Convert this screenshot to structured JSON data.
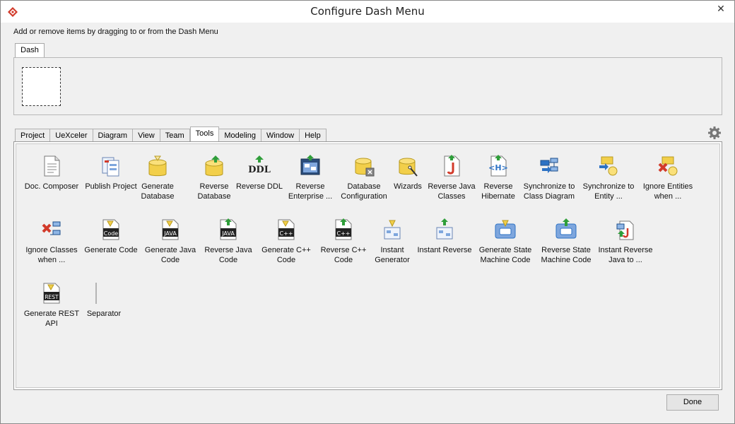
{
  "window": {
    "title": "Configure Dash Menu",
    "close_glyph": "✕"
  },
  "hint": "Add or remove items by dragging to or from the Dash Menu",
  "dash": {
    "tab_label": "Dash"
  },
  "tabs": [
    "Project",
    "UeXceler",
    "Diagram",
    "View",
    "Team",
    "Tools",
    "Modeling",
    "Window",
    "Help"
  ],
  "active_tab": "Tools",
  "items": [
    {
      "label": "Doc. Composer",
      "icon": "doc-composer-icon"
    },
    {
      "label": "Publish Project",
      "icon": "publish-project-icon"
    },
    {
      "label": "Generate\nDatabase",
      "icon": "generate-database-icon"
    },
    {
      "label": "Reverse\nDatabase",
      "icon": "reverse-database-icon"
    },
    {
      "label": "Reverse DDL",
      "icon": "reverse-ddl-icon"
    },
    {
      "label": "Reverse\nEnterprise ...",
      "icon": "reverse-enterprise-icon"
    },
    {
      "label": "Database\nConfiguration",
      "icon": "database-configuration-icon"
    },
    {
      "label": "Wizards",
      "icon": "wizards-icon"
    },
    {
      "label": "Reverse Java\nClasses",
      "icon": "reverse-java-classes-icon"
    },
    {
      "label": "Reverse\nHibernate",
      "icon": "reverse-hibernate-icon"
    },
    {
      "label": "Synchronize to\nClass Diagram",
      "icon": "sync-class-diagram-icon"
    },
    {
      "label": "Synchronize to\nEntity ...",
      "icon": "sync-entity-icon"
    },
    {
      "label": "Ignore Entities\nwhen ...",
      "icon": "ignore-entities-icon"
    },
    {
      "label": "Ignore Classes\nwhen ...",
      "icon": "ignore-classes-icon"
    },
    {
      "label": "Generate Code",
      "icon": "generate-code-icon"
    },
    {
      "label": "Generate Java\nCode",
      "icon": "generate-java-code-icon"
    },
    {
      "label": "Reverse Java\nCode",
      "icon": "reverse-java-code-icon"
    },
    {
      "label": "Generate C++\nCode",
      "icon": "generate-cpp-code-icon"
    },
    {
      "label": "Reverse C++\nCode",
      "icon": "reverse-cpp-code-icon"
    },
    {
      "label": "Instant\nGenerator",
      "icon": "instant-generator-icon"
    },
    {
      "label": "Instant Reverse",
      "icon": "instant-reverse-icon"
    },
    {
      "label": "Generate State\nMachine Code",
      "icon": "generate-state-machine-icon"
    },
    {
      "label": "Reverse State\nMachine Code",
      "icon": "reverse-state-machine-icon"
    },
    {
      "label": "Instant Reverse\nJava to ...",
      "icon": "instant-reverse-java-icon"
    },
    {
      "label": "Generate REST\nAPI",
      "icon": "generate-rest-api-icon"
    },
    {
      "label": "Separator",
      "icon": "separator-icon"
    }
  ],
  "icon_text": {
    "ddl": "DDL",
    "code": "Code",
    "java": "JAVA",
    "cpp": "C++",
    "rest": "REST"
  },
  "buttons": {
    "done": "Done"
  },
  "colors": {
    "accent_green": "#2f9e3a",
    "db_yellow": "#f2cf4a",
    "java_red": "#d23a2a",
    "blue": "#2d72c4"
  }
}
